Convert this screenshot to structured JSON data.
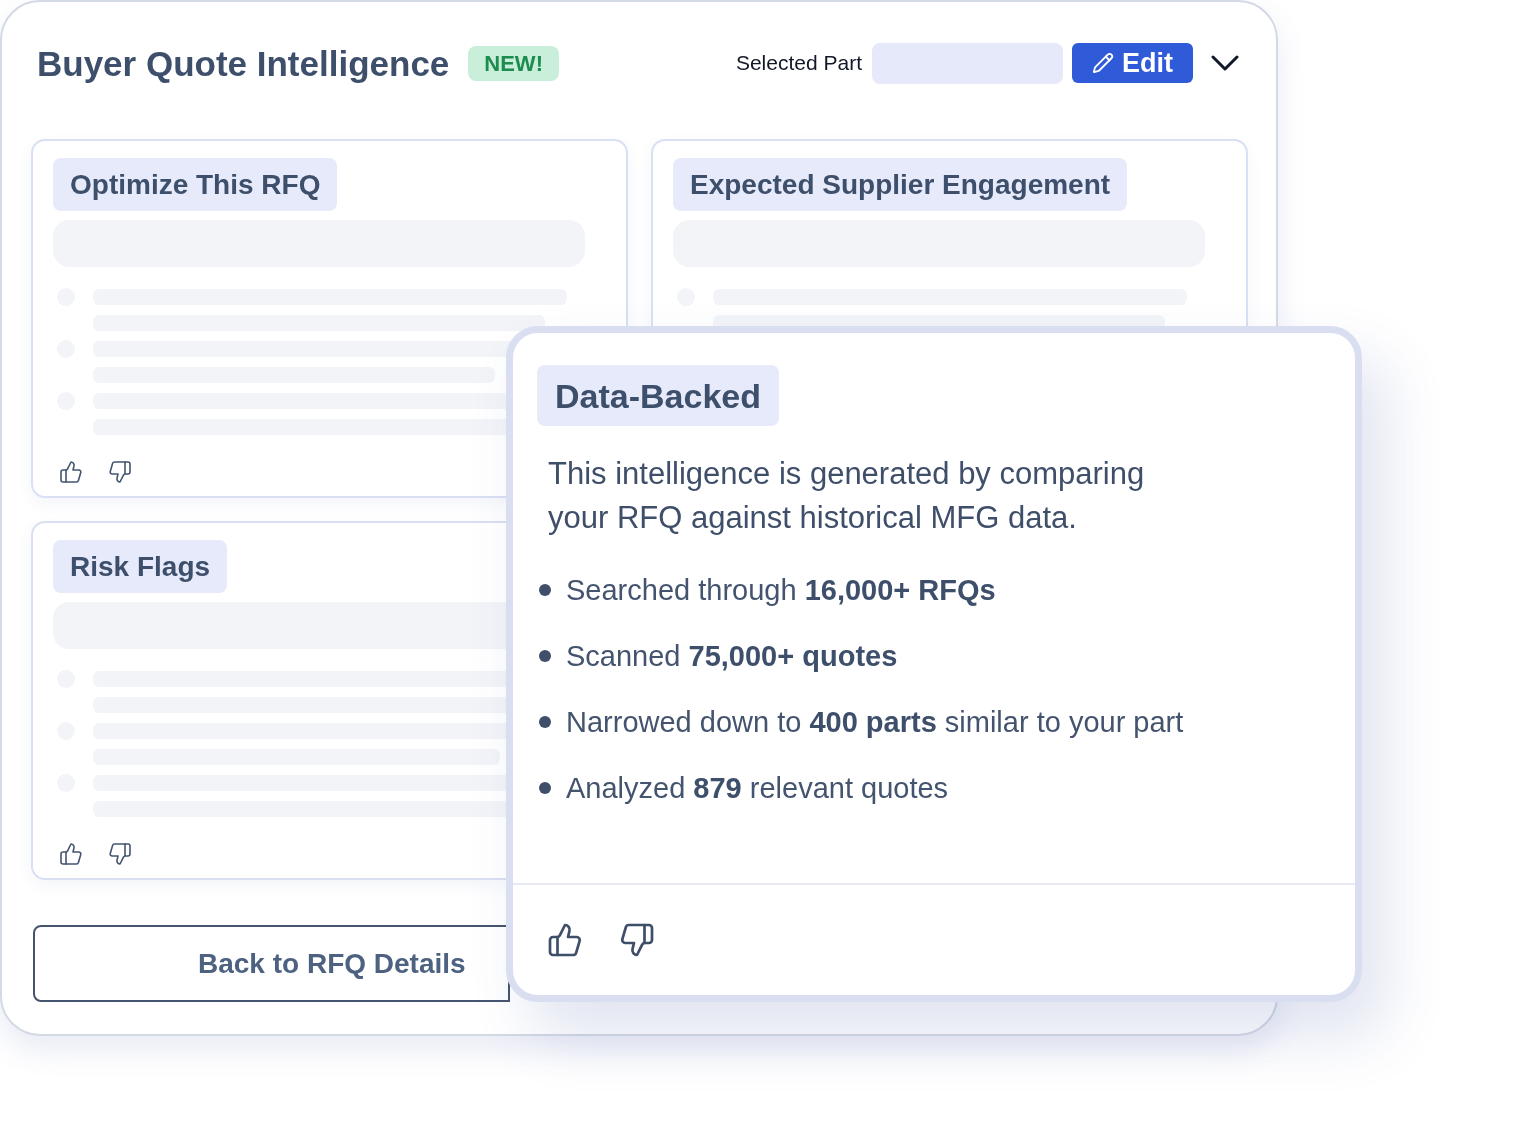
{
  "header": {
    "title": "Buyer Quote Intelligence",
    "badge": "NEW!",
    "selected_part_label": "Selected Part",
    "edit_button": "Edit"
  },
  "cards": [
    {
      "title": "Optimize This RFQ"
    },
    {
      "title": "Expected Supplier Engagement"
    },
    {
      "title": "Risk Flags"
    }
  ],
  "back_button": "Back to RFQ Details",
  "popup": {
    "title": "Data-Backed",
    "description": "This intelligence is generated by comparing your RFQ against historical MFG data.",
    "facts": [
      "Searched through **16,000+ RFQs**",
      "Scanned **75,000+ quotes**",
      "Narrowed down to **400 parts** similar to your part",
      "Analyzed **879** relevant quotes"
    ]
  }
}
